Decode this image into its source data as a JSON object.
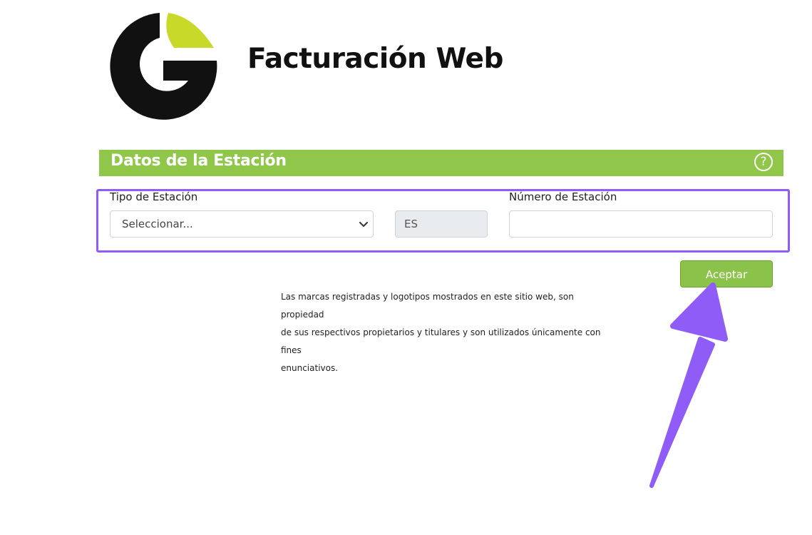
{
  "brand": {
    "logo_icon": "g-logo-icon",
    "app_title": "Facturación Web",
    "colors": {
      "primary_green": "#90c74b",
      "logo_lime": "#c8d92a",
      "logo_black": "#111111",
      "annotation_purple": "#8f5cf7"
    }
  },
  "section": {
    "title": "Datos de la Estación",
    "help_icon": "help-circle-icon",
    "help_glyph": "?"
  },
  "form": {
    "tipo_label": "Tipo de Estación",
    "tipo_selected": "Seleccionar...",
    "prefix": "ES",
    "numero_label": "Número de Estación",
    "numero_value": "",
    "numero_placeholder": ""
  },
  "actions": {
    "accept_label": "Aceptar"
  },
  "footer": {
    "disclaimer_line1": "Las marcas registradas y logotipos mostrados en este sitio web, son propiedad",
    "disclaimer_line2": "de sus respectivos propietarios y titulares y son utilizados únicamente con fines",
    "disclaimer_line3": "enunciativos."
  },
  "annotation": {
    "icon": "arrow-annotation-icon"
  }
}
